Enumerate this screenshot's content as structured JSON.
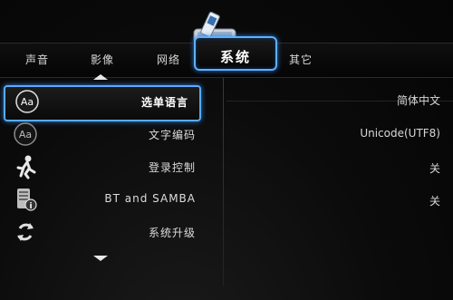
{
  "tabs": [
    {
      "label": "声音"
    },
    {
      "label": "影像"
    },
    {
      "label": "网络"
    },
    {
      "label": "系统"
    },
    {
      "label": "其它"
    }
  ],
  "active_tab": "系统",
  "menu": [
    {
      "label": "选单语言",
      "icon": "aa-language-icon",
      "selected": true
    },
    {
      "label": "文字编码",
      "icon": "aa-encoding-icon",
      "selected": false
    },
    {
      "label": "登录控制",
      "icon": "running-man-icon",
      "selected": false
    },
    {
      "label": "BT and SAMBA",
      "icon": "server-info-icon",
      "selected": false
    },
    {
      "label": "系统升级",
      "icon": "refresh-arrows-icon",
      "selected": false
    }
  ],
  "values": [
    {
      "text": "简体中文"
    },
    {
      "text": "Unicode(UTF8)"
    },
    {
      "text": "关"
    },
    {
      "text": "关"
    }
  ],
  "colors": {
    "highlight": "#59aaff",
    "background": "#0b0b0b"
  }
}
